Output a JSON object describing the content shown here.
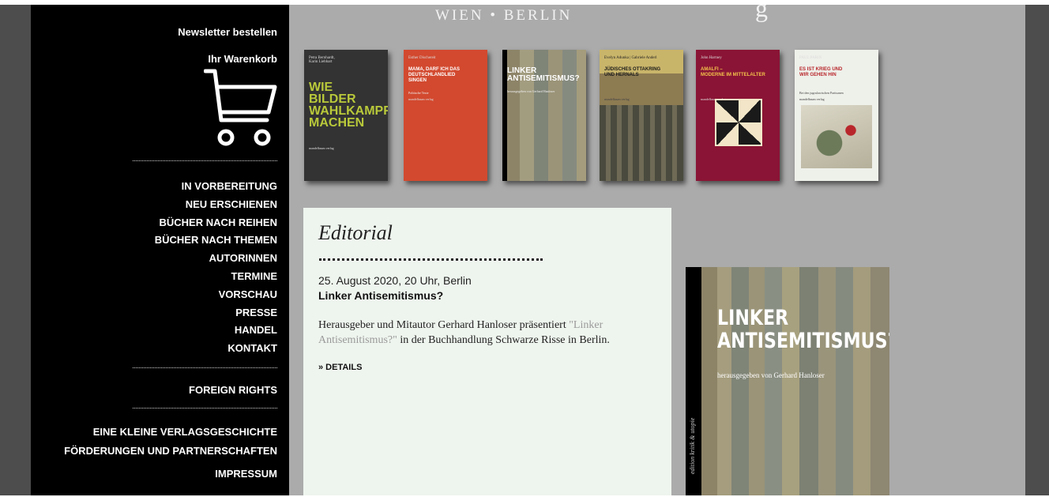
{
  "header": {
    "tagline": "WIEN • BERLIN",
    "tagline_tail": "g"
  },
  "sidebar": {
    "newsletter": "Newsletter bestellen",
    "cart_label": "Ihr Warenkorb",
    "nav": [
      "IN VORBEREITUNG",
      "NEU ERSCHIENEN",
      "BÜCHER NACH REIHEN",
      "BÜCHER NACH THEMEN",
      "AUTORiNNEN",
      "TERMINE",
      "VORSCHAU",
      "PRESSE",
      "HANDEL",
      "KONTAKT"
    ],
    "foreign_rights": "FOREIGN RIGHTS",
    "history": "EINE KLEINE VERLAGSGESCHICHTE",
    "funding": "FÖRDERUNGEN UND PARTNERSCHAFTEN",
    "impressum": "IMPRESSUM"
  },
  "books": [
    {
      "author": "Petra Bernhardt,\nKarin Liebhart",
      "title": "WIE\nBILDER\nWAHLKAMPF\nMACHEN",
      "publisher": "mandelbaum verlag",
      "bg": "#333333",
      "fg": "#b9c93a"
    },
    {
      "author": "Esther Dischereit",
      "title": "MAMA, DARF ICH DAS\nDEUTSCHLANDLIED\nSINGEN",
      "subtitle": "Politische Texte",
      "publisher": "mandelbaum verlag",
      "bg": "#d2492f",
      "fg": "#ffffff"
    },
    {
      "title": "LINKER\nANTISEMITISMUS?",
      "subtitle": "herausgegeben von Gerhard Hanloser",
      "bg": "#8e8a72",
      "fg": "#ffffff"
    },
    {
      "author": "Evelyn Adunka | Gabriele Anderl",
      "title": "JÜDISCHES OTTAKRING\nUND HERNALS",
      "publisher": "mandelbaum verlag",
      "bg": "#7d6a3d",
      "fg": "#1a1a1a"
    },
    {
      "author": "John Hartney",
      "title": "AMALFI –\nMODERNE IM MITTELALTER",
      "publisher": "mandelbaum verlag",
      "bg": "#8a1435",
      "fg": "#f1c14b"
    },
    {
      "author": "PAUL PARIN",
      "title": "ES IST KRIEG UND\nWIR GEHEN HIN",
      "subtitle": "Bei den jugoslawischen Partisanen",
      "publisher": "mandelbaum verlag",
      "bg": "#eef0ea",
      "fg": "#b8262b"
    }
  ],
  "editorial": {
    "title": "Editorial",
    "date": "25. August 2020, 20 Uhr, Berlin",
    "headline": "Linker Antisemitismus?",
    "text_before": "Herausgeber und Mitautor Gerhard Hanloser präsentiert ",
    "link": "\"Linker Antisemitismus?\"",
    "text_after": " in der Buchhandlung Schwarze Risse in Berlin.",
    "details": "» DETAILS"
  },
  "featured_book": {
    "title": "LINKER\nANTISEMITISMUS?",
    "subtitle": "herausgegeben von Gerhard Hanloser",
    "spine": "edition kritik & utopie"
  }
}
